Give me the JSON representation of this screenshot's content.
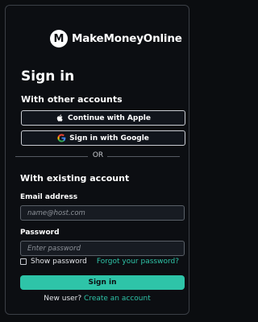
{
  "brand": {
    "mark": "M",
    "name": "MakeMoneyOnline"
  },
  "title": "Sign in",
  "other_accounts": {
    "heading": "With other accounts",
    "apple_label": "Continue with Apple",
    "google_label": "Sign in with Google"
  },
  "divider_text": "OR",
  "existing_account": {
    "heading": "With existing account",
    "email_label": "Email address",
    "email_placeholder": "name@host.com",
    "email_value": "",
    "password_label": "Password",
    "password_placeholder": "Enter password",
    "password_value": "",
    "show_password_label": "Show password",
    "show_password_checked": false,
    "forgot_label": "Forgot your password?",
    "submit_label": "Sign in"
  },
  "footer": {
    "prompt": "New user?",
    "link": "Create an account"
  },
  "colors": {
    "accent": "#2ec4a8",
    "background": "#0b0d10",
    "google_red": "#ea4335",
    "google_blue": "#4285f4",
    "google_yellow": "#fbbc05",
    "google_green": "#34a853"
  }
}
